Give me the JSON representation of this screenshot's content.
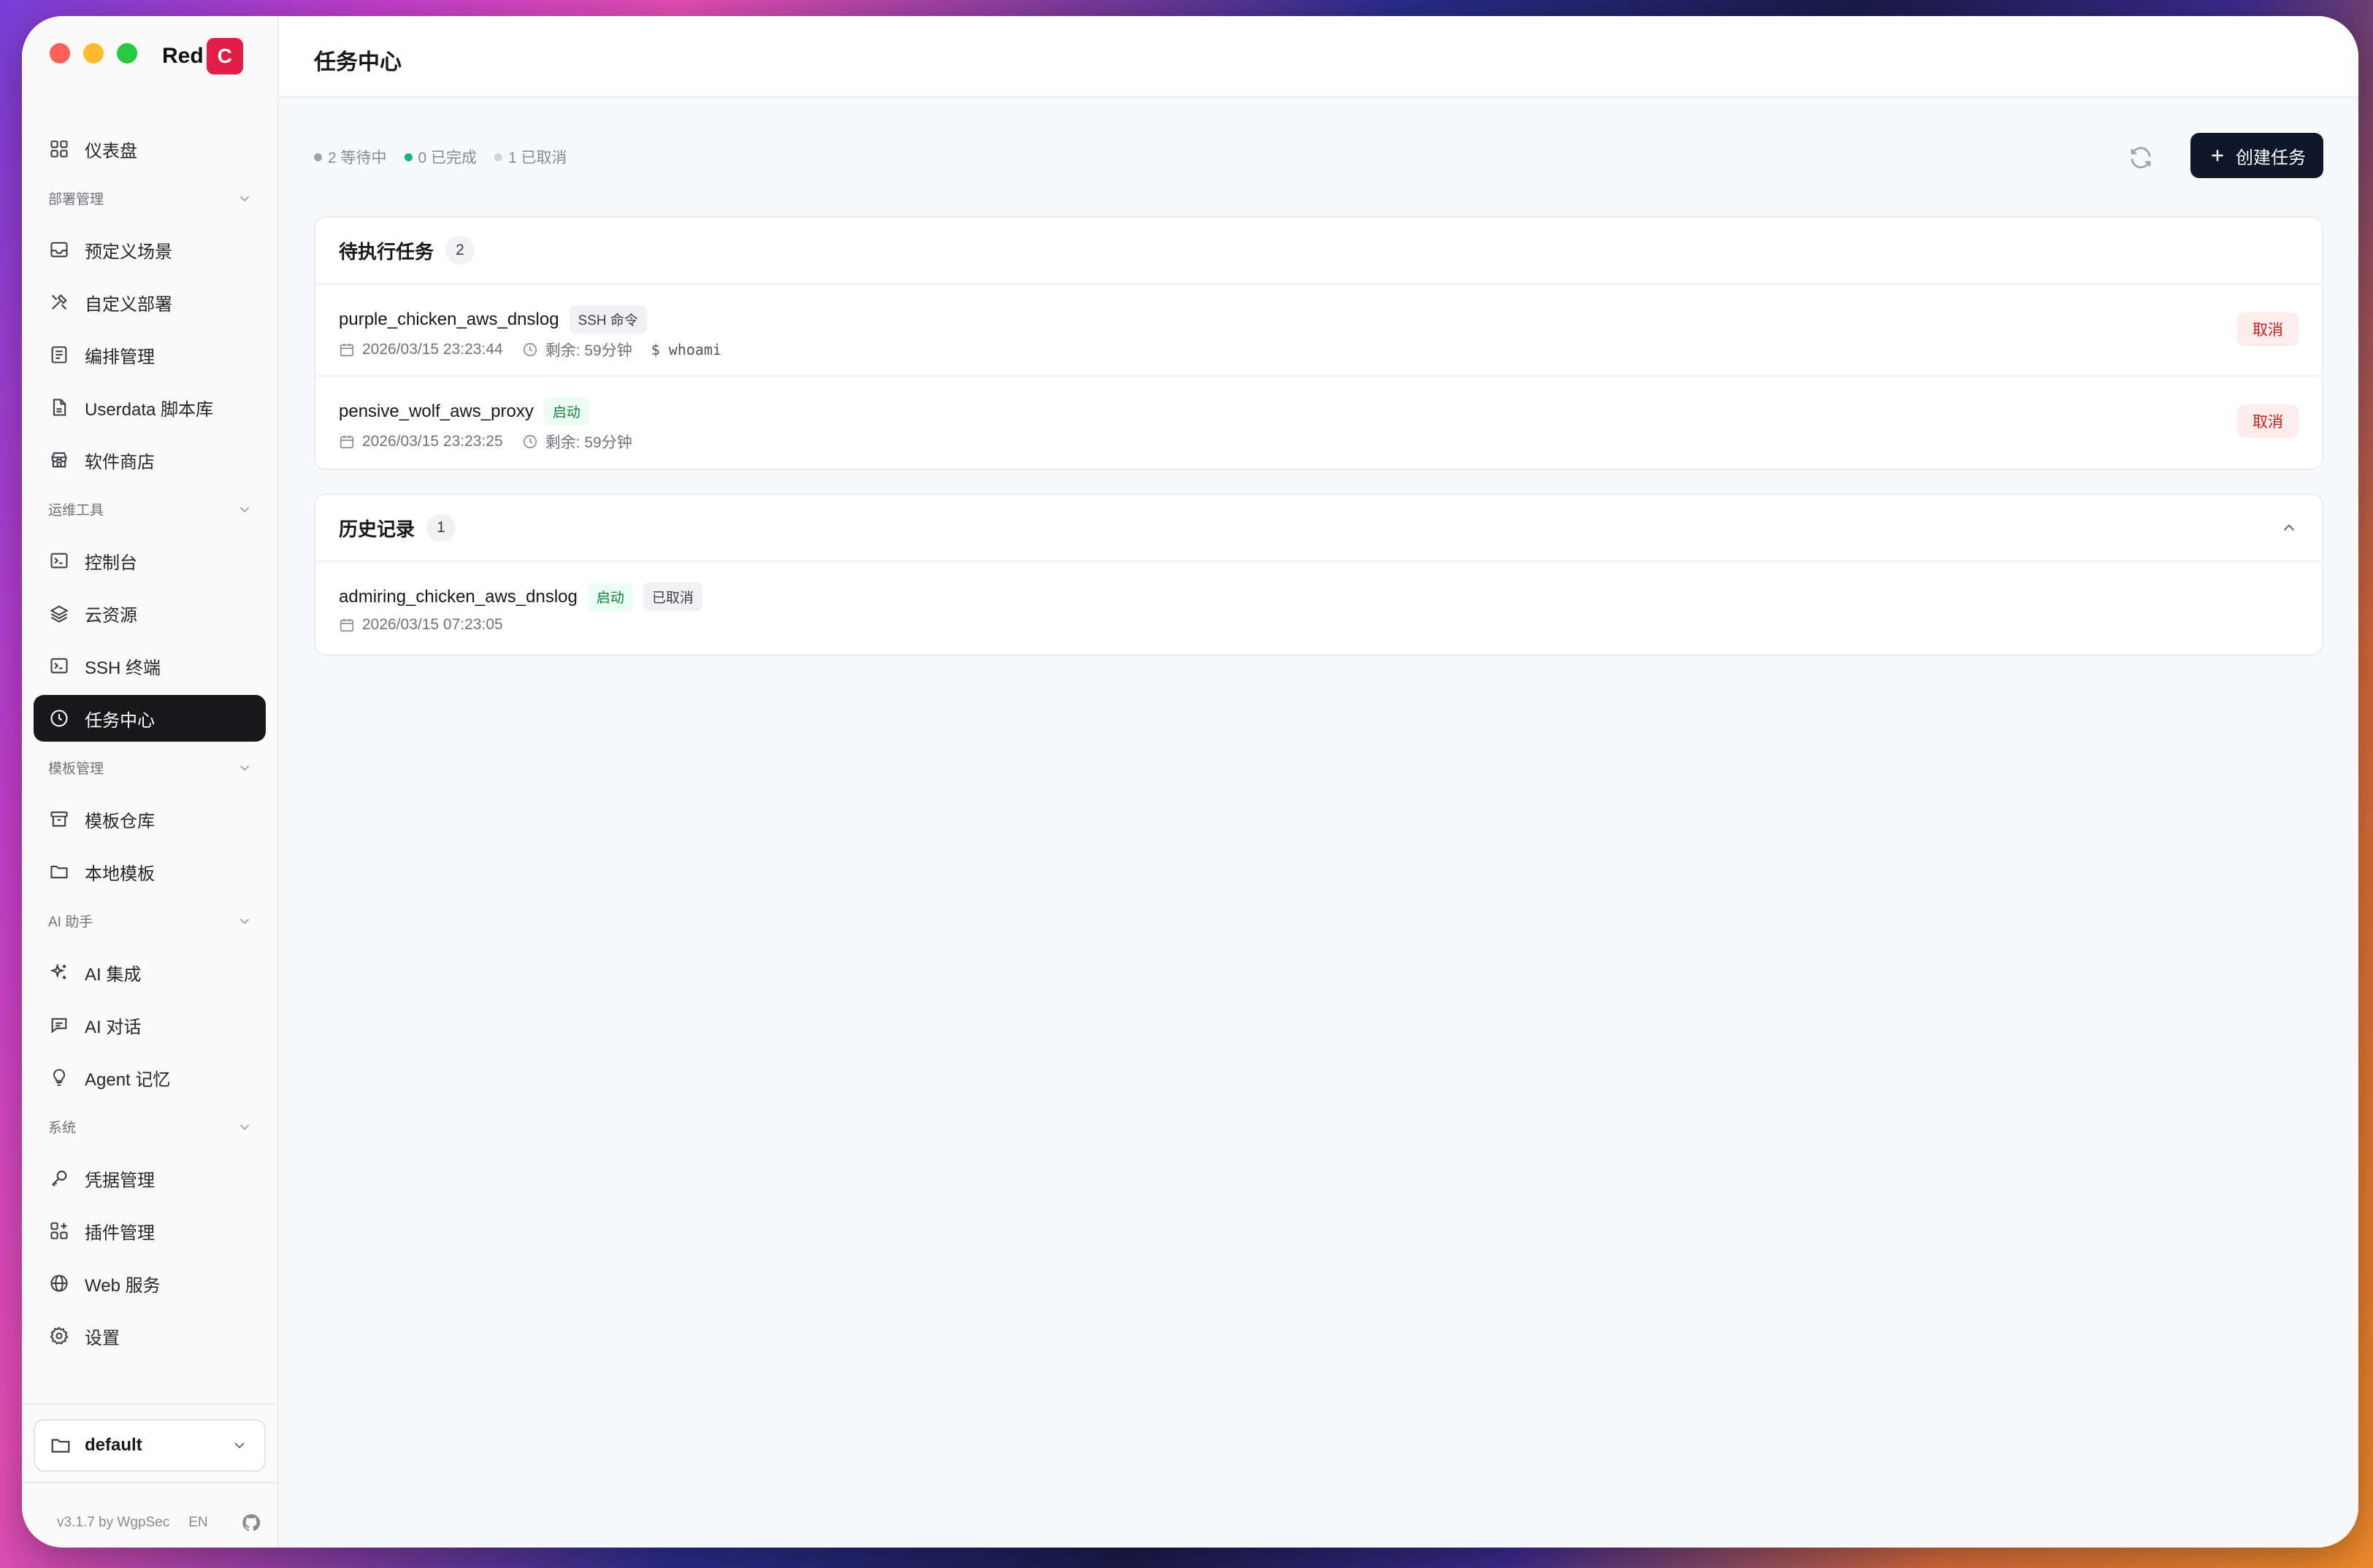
{
  "app": {
    "brand_text": "Red",
    "brand_badge": "C",
    "version": "v3.1.7 by WgpSec",
    "lang": "EN",
    "workspace": "default"
  },
  "sidebar": {
    "dashboard": "仪表盘",
    "sections": [
      {
        "label": "部署管理",
        "items": [
          "预定义场景",
          "自定义部署",
          "编排管理",
          "Userdata 脚本库",
          "软件商店"
        ]
      },
      {
        "label": "运维工具",
        "items": [
          "控制台",
          "云资源",
          "SSH 终端",
          "任务中心"
        ]
      },
      {
        "label": "模板管理",
        "items": [
          "模板仓库",
          "本地模板"
        ]
      },
      {
        "label": "AI 助手",
        "items": [
          "AI 集成",
          "AI 对话",
          "Agent 记忆"
        ]
      },
      {
        "label": "系统",
        "items": [
          "凭据管理",
          "插件管理",
          "Web 服务",
          "设置"
        ]
      }
    ],
    "active_item": "任务中心"
  },
  "page": {
    "title": "任务中心",
    "stats": {
      "pending": "2 等待中",
      "completed": "0 已完成",
      "cancelled": "1 已取消"
    },
    "create_button": "创建任务",
    "colors": {
      "pending_dot": "#a1a1aa",
      "completed_dot": "#10b981",
      "cancelled_dot": "#d4d4d8",
      "primary": "#0f172a",
      "danger": "#c81e1e"
    }
  },
  "pending_card": {
    "title": "待执行任务",
    "count": "2",
    "tasks": [
      {
        "name": "purple_chicken_aws_dnslog",
        "tag": "SSH 命令",
        "time": "2026/03/15 23:23:44",
        "remaining": "剩余: 59分钟",
        "command": "$ whoami",
        "cancel": "取消"
      },
      {
        "name": "pensive_wolf_aws_proxy",
        "tag": "启动",
        "time": "2026/03/15 23:23:25",
        "remaining": "剩余: 59分钟",
        "cancel": "取消"
      }
    ]
  },
  "history_card": {
    "title": "历史记录",
    "count": "1",
    "tasks": [
      {
        "name": "admiring_chicken_aws_dnslog",
        "tag": "启动",
        "status": "已取消",
        "time": "2026/03/15 07:23:05"
      }
    ]
  }
}
